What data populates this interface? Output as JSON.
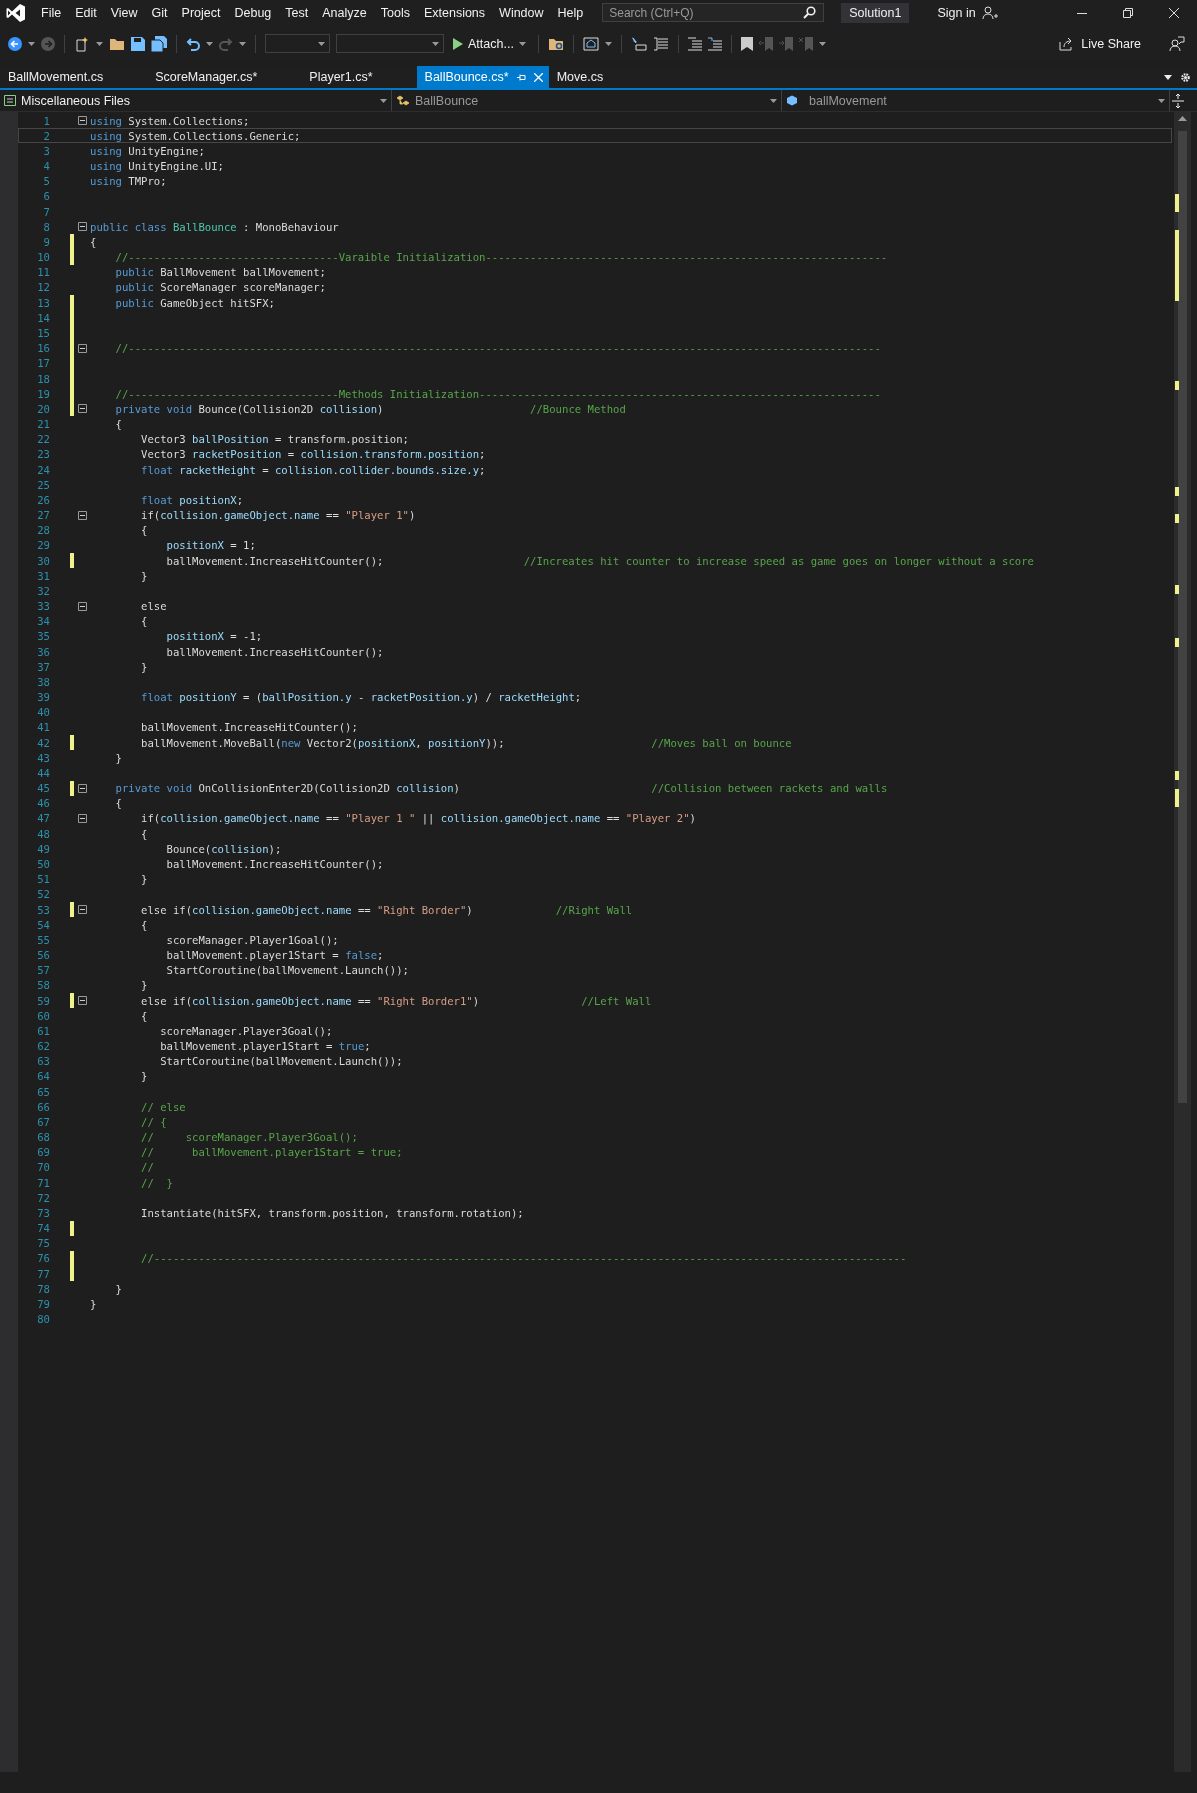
{
  "menu_bar": {
    "items": [
      "File",
      "Edit",
      "View",
      "Git",
      "Project",
      "Debug",
      "Test",
      "Analyze",
      "Tools",
      "Extensions",
      "Window",
      "Help"
    ],
    "search": {
      "placeholder": "Search (Ctrl+Q)"
    },
    "solution": "Solution1",
    "sign_in": "Sign in"
  },
  "toolbar": {
    "attach": "Attach...",
    "live_share": "Live Share"
  },
  "tabs": [
    {
      "label": "BallMovement.cs",
      "selected": false
    },
    {
      "label": "ScoreManager.cs*",
      "selected": false
    },
    {
      "label": "Player1.cs*",
      "selected": false
    },
    {
      "label": "BallBounce.cs*",
      "selected": true
    },
    {
      "label": "Move.cs",
      "selected": false
    }
  ],
  "nav_bar": {
    "project": "Miscellaneous Files",
    "type": "BallBounce",
    "member": "ballMovement"
  },
  "editor": {
    "lines": [
      {
        "number": "1",
        "current": false,
        "changed": false,
        "fold": true,
        "spans": [
          {
            "kind": "keyword",
            "text": "using"
          },
          {
            "kind": "plain",
            "text": " System.Collections;"
          }
        ]
      },
      {
        "number": "2",
        "current": true,
        "changed": false,
        "fold": false,
        "spans": [
          {
            "kind": "keyword",
            "text": "using"
          },
          {
            "kind": "plain",
            "text": " System.Collections.Generic;"
          }
        ]
      },
      {
        "number": "3",
        "current": false,
        "changed": false,
        "fold": false,
        "spans": [
          {
            "kind": "keyword",
            "text": "using"
          },
          {
            "kind": "plain",
            "text": " UnityEngine;"
          }
        ]
      },
      {
        "number": "4",
        "current": false,
        "changed": false,
        "fold": false,
        "spans": [
          {
            "kind": "keyword",
            "text": "using"
          },
          {
            "kind": "plain",
            "text": " UnityEngine.UI;"
          }
        ]
      },
      {
        "number": "5",
        "current": false,
        "changed": false,
        "fold": false,
        "spans": [
          {
            "kind": "keyword",
            "text": "using"
          },
          {
            "kind": "plain",
            "text": " TMPro;"
          }
        ]
      },
      {
        "number": "6",
        "current": false,
        "changed": false,
        "fold": false
      },
      {
        "number": "7",
        "current": false,
        "changed": false,
        "fold": false
      },
      {
        "number": "8",
        "current": false,
        "changed": false,
        "fold": true,
        "spans": [
          {
            "kind": "keyword",
            "text": "public class "
          },
          {
            "kind": "type",
            "text": "BallBounce"
          },
          {
            "kind": "plain",
            "text": " : MonoBehaviour"
          }
        ]
      },
      {
        "number": "9",
        "current": false,
        "changed": true,
        "fold": false,
        "spans": [
          {
            "kind": "plain",
            "text": "{"
          }
        ]
      },
      {
        "number": "10",
        "current": false,
        "changed": true,
        "fold": false,
        "spans": [
          {
            "kind": "comment",
            "text": "    //---------------------------------Varaible Initialization---------------------------------------------------------------"
          }
        ]
      },
      {
        "number": "11",
        "current": false,
        "changed": false,
        "fold": false,
        "spans": [
          {
            "kind": "keyword",
            "text": "    public"
          },
          {
            "kind": "plain",
            "text": " BallMovement ballMovement;"
          }
        ]
      },
      {
        "number": "12",
        "current": false,
        "changed": false,
        "fold": false,
        "spans": [
          {
            "kind": "keyword",
            "text": "    public"
          },
          {
            "kind": "plain",
            "text": " ScoreManager scoreManager;"
          }
        ]
      },
      {
        "number": "13",
        "current": false,
        "changed": true,
        "fold": false,
        "spans": [
          {
            "kind": "keyword",
            "text": "    public"
          },
          {
            "kind": "plain",
            "text": " GameObject hitSFX;"
          }
        ]
      },
      {
        "number": "14",
        "current": false,
        "changed": true,
        "fold": false
      },
      {
        "number": "15",
        "current": false,
        "changed": true,
        "fold": false
      },
      {
        "number": "16",
        "current": false,
        "changed": true,
        "fold": true,
        "spans": [
          {
            "kind": "comment",
            "text": "    //----------------------------------------------------------------------------------------------------------------------"
          }
        ]
      },
      {
        "number": "17",
        "current": false,
        "changed": true,
        "fold": false
      },
      {
        "number": "18",
        "current": false,
        "changed": true,
        "fold": false
      },
      {
        "number": "19",
        "current": false,
        "changed": true,
        "fold": false,
        "spans": [
          {
            "kind": "comment",
            "text": "    //---------------------------------Methods Initialization---------------------------------------------------------------"
          }
        ]
      },
      {
        "number": "20",
        "current": false,
        "changed": true,
        "fold": true,
        "spans": [
          {
            "kind": "keyword",
            "text": "    private void"
          },
          {
            "kind": "plain",
            "text": " Bounce(Collision2D "
          },
          {
            "kind": "variable",
            "text": "collision"
          },
          {
            "kind": "plain",
            "text": ")                       "
          },
          {
            "kind": "comment",
            "text": "//Bounce Method"
          }
        ]
      },
      {
        "number": "21",
        "current": false,
        "changed": false,
        "fold": false,
        "spans": [
          {
            "kind": "plain",
            "text": "    {"
          }
        ]
      },
      {
        "number": "22",
        "current": false,
        "changed": false,
        "fold": false,
        "spans": [
          {
            "kind": "plain",
            "text": "        Vector3 "
          },
          {
            "kind": "variable",
            "text": "ballPosition"
          },
          {
            "kind": "plain",
            "text": " = transform.position;"
          }
        ]
      },
      {
        "number": "23",
        "current": false,
        "changed": false,
        "fold": false,
        "spans": [
          {
            "kind": "plain",
            "text": "        Vector3 "
          },
          {
            "kind": "variable",
            "text": "racketPosition"
          },
          {
            "kind": "plain",
            "text": " = "
          },
          {
            "kind": "variable",
            "text": "collision.transform.position"
          },
          {
            "kind": "plain",
            "text": ";"
          }
        ]
      },
      {
        "number": "24",
        "current": false,
        "changed": false,
        "fold": false,
        "spans": [
          {
            "kind": "keyword",
            "text": "        float "
          },
          {
            "kind": "variable",
            "text": "racketHeight"
          },
          {
            "kind": "plain",
            "text": " = "
          },
          {
            "kind": "variable",
            "text": "collision.collider.bounds.size.y"
          },
          {
            "kind": "plain",
            "text": ";"
          }
        ]
      },
      {
        "number": "25",
        "current": false,
        "changed": false,
        "fold": false
      },
      {
        "number": "26",
        "current": false,
        "changed": false,
        "fold": false,
        "spans": [
          {
            "kind": "keyword",
            "text": "        float "
          },
          {
            "kind": "variable",
            "text": "positionX"
          },
          {
            "kind": "plain",
            "text": ";"
          }
        ]
      },
      {
        "number": "27",
        "current": false,
        "changed": false,
        "fold": true,
        "spans": [
          {
            "kind": "plain",
            "text": "        if("
          },
          {
            "kind": "variable",
            "text": "collision.gameObject.name"
          },
          {
            "kind": "plain",
            "text": " == "
          },
          {
            "kind": "string",
            "text": "\"Player 1\""
          },
          {
            "kind": "plain",
            "text": ")"
          }
        ]
      },
      {
        "number": "28",
        "current": false,
        "changed": false,
        "fold": false,
        "spans": [
          {
            "kind": "plain",
            "text": "        {"
          }
        ]
      },
      {
        "number": "29",
        "current": false,
        "changed": false,
        "fold": false,
        "spans": [
          {
            "kind": "variable",
            "text": "            positionX"
          },
          {
            "kind": "plain",
            "text": " = 1;"
          }
        ]
      },
      {
        "number": "30",
        "current": false,
        "changed": true,
        "fold": false,
        "spans": [
          {
            "kind": "plain",
            "text": "            ballMovement.IncreaseHitCounter();                      "
          },
          {
            "kind": "comment",
            "text": "//Increates hit counter to increase speed as game goes on longer without a score"
          }
        ]
      },
      {
        "number": "31",
        "current": false,
        "changed": false,
        "fold": false,
        "spans": [
          {
            "kind": "plain",
            "text": "        }"
          }
        ]
      },
      {
        "number": "32",
        "current": false,
        "changed": false,
        "fold": false
      },
      {
        "number": "33",
        "current": false,
        "changed": false,
        "fold": true,
        "spans": [
          {
            "kind": "plain",
            "text": "        else"
          }
        ]
      },
      {
        "number": "34",
        "current": false,
        "changed": false,
        "fold": false,
        "spans": [
          {
            "kind": "plain",
            "text": "        {"
          }
        ]
      },
      {
        "number": "35",
        "current": false,
        "changed": false,
        "fold": false,
        "spans": [
          {
            "kind": "variable",
            "text": "            positionX"
          },
          {
            "kind": "plain",
            "text": " = -1;"
          }
        ]
      },
      {
        "number": "36",
        "current": false,
        "changed": false,
        "fold": false,
        "spans": [
          {
            "kind": "plain",
            "text": "            ballMovement.IncreaseHitCounter();"
          }
        ]
      },
      {
        "number": "37",
        "current": false,
        "changed": false,
        "fold": false,
        "spans": [
          {
            "kind": "plain",
            "text": "        }"
          }
        ]
      },
      {
        "number": "38",
        "current": false,
        "changed": false,
        "fold": false
      },
      {
        "number": "39",
        "current": false,
        "changed": false,
        "fold": false,
        "spans": [
          {
            "kind": "keyword",
            "text": "        float "
          },
          {
            "kind": "variable",
            "text": "positionY"
          },
          {
            "kind": "plain",
            "text": " = ("
          },
          {
            "kind": "variable",
            "text": "ballPosition.y"
          },
          {
            "kind": "plain",
            "text": " - "
          },
          {
            "kind": "variable",
            "text": "racketPosition.y"
          },
          {
            "kind": "plain",
            "text": ") / "
          },
          {
            "kind": "variable",
            "text": "racketHeight"
          },
          {
            "kind": "plain",
            "text": ";"
          }
        ]
      },
      {
        "number": "40",
        "current": false,
        "changed": false,
        "fold": false
      },
      {
        "number": "41",
        "current": false,
        "changed": false,
        "fold": false,
        "spans": [
          {
            "kind": "plain",
            "text": "        ballMovement.IncreaseHitCounter();"
          }
        ]
      },
      {
        "number": "42",
        "current": false,
        "changed": true,
        "fold": false,
        "spans": [
          {
            "kind": "plain",
            "text": "        ballMovement.MoveBall("
          },
          {
            "kind": "keyword",
            "text": "new"
          },
          {
            "kind": "plain",
            "text": " Vector2("
          },
          {
            "kind": "variable",
            "text": "positionX"
          },
          {
            "kind": "plain",
            "text": ", "
          },
          {
            "kind": "variable",
            "text": "positionY"
          },
          {
            "kind": "plain",
            "text": "));                       "
          },
          {
            "kind": "comment",
            "text": "//Moves ball on bounce"
          }
        ]
      },
      {
        "number": "43",
        "current": false,
        "changed": false,
        "fold": false,
        "spans": [
          {
            "kind": "plain",
            "text": "    }"
          }
        ]
      },
      {
        "number": "44",
        "current": false,
        "changed": false,
        "fold": false
      },
      {
        "number": "45",
        "current": false,
        "changed": true,
        "fold": true,
        "spans": [
          {
            "kind": "keyword",
            "text": "    private void"
          },
          {
            "kind": "plain",
            "text": " OnCollisionEnter2D(Collision2D "
          },
          {
            "kind": "variable",
            "text": "collision"
          },
          {
            "kind": "plain",
            "text": ")                              "
          },
          {
            "kind": "comment",
            "text": "//Collision between rackets and walls"
          }
        ]
      },
      {
        "number": "46",
        "current": false,
        "changed": false,
        "fold": false,
        "spans": [
          {
            "kind": "plain",
            "text": "    {"
          }
        ]
      },
      {
        "number": "47",
        "current": false,
        "changed": false,
        "fold": true,
        "spans": [
          {
            "kind": "plain",
            "text": "        if("
          },
          {
            "kind": "variable",
            "text": "collision.gameObject.name"
          },
          {
            "kind": "plain",
            "text": " == "
          },
          {
            "kind": "string",
            "text": "\"Player 1 \""
          },
          {
            "kind": "plain",
            "text": " || "
          },
          {
            "kind": "variable",
            "text": "collision.gameObject.name"
          },
          {
            "kind": "plain",
            "text": " == "
          },
          {
            "kind": "string",
            "text": "\"Player 2\""
          },
          {
            "kind": "plain",
            "text": ")"
          }
        ]
      },
      {
        "number": "48",
        "current": false,
        "changed": false,
        "fold": false,
        "spans": [
          {
            "kind": "plain",
            "text": "        {"
          }
        ]
      },
      {
        "number": "49",
        "current": false,
        "changed": false,
        "fold": false,
        "spans": [
          {
            "kind": "plain",
            "text": "            Bounce("
          },
          {
            "kind": "variable",
            "text": "collision"
          },
          {
            "kind": "plain",
            "text": ");"
          }
        ]
      },
      {
        "number": "50",
        "current": false,
        "changed": false,
        "fold": false,
        "spans": [
          {
            "kind": "plain",
            "text": "            ballMovement.IncreaseHitCounter();"
          }
        ]
      },
      {
        "number": "51",
        "current": false,
        "changed": false,
        "fold": false,
        "spans": [
          {
            "kind": "plain",
            "text": "        }"
          }
        ]
      },
      {
        "number": "52",
        "current": false,
        "changed": false,
        "fold": false
      },
      {
        "number": "53",
        "current": false,
        "changed": true,
        "fold": true,
        "spans": [
          {
            "kind": "plain",
            "text": "        else if("
          },
          {
            "kind": "variable",
            "text": "collision.gameObject.name"
          },
          {
            "kind": "plain",
            "text": " == "
          },
          {
            "kind": "string",
            "text": "\"Right Border\""
          },
          {
            "kind": "plain",
            "text": ")             "
          },
          {
            "kind": "comment",
            "text": "//Right Wall"
          }
        ]
      },
      {
        "number": "54",
        "current": false,
        "changed": false,
        "fold": false,
        "spans": [
          {
            "kind": "plain",
            "text": "        {"
          }
        ]
      },
      {
        "number": "55",
        "current": false,
        "changed": false,
        "fold": false,
        "spans": [
          {
            "kind": "plain",
            "text": "            scoreManager.Player1Goal();"
          }
        ]
      },
      {
        "number": "56",
        "current": false,
        "changed": false,
        "fold": false,
        "spans": [
          {
            "kind": "plain",
            "text": "            ballMovement.player1Start = "
          },
          {
            "kind": "keyword",
            "text": "false"
          },
          {
            "kind": "plain",
            "text": ";"
          }
        ]
      },
      {
        "number": "57",
        "current": false,
        "changed": false,
        "fold": false,
        "spans": [
          {
            "kind": "plain",
            "text": "            StartCoroutine(ballMovement.Launch());"
          }
        ]
      },
      {
        "number": "58",
        "current": false,
        "changed": false,
        "fold": false,
        "spans": [
          {
            "kind": "plain",
            "text": "        }"
          }
        ]
      },
      {
        "number": "59",
        "current": false,
        "changed": true,
        "fold": true,
        "spans": [
          {
            "kind": "plain",
            "text": "        else if("
          },
          {
            "kind": "variable",
            "text": "collision.gameObject.name"
          },
          {
            "kind": "plain",
            "text": " == "
          },
          {
            "kind": "string",
            "text": "\"Right Border1\""
          },
          {
            "kind": "plain",
            "text": ")                "
          },
          {
            "kind": "comment",
            "text": "//Left Wall"
          }
        ]
      },
      {
        "number": "60",
        "current": false,
        "changed": false,
        "fold": false,
        "spans": [
          {
            "kind": "plain",
            "text": "        {"
          }
        ]
      },
      {
        "number": "61",
        "current": false,
        "changed": false,
        "fold": false,
        "spans": [
          {
            "kind": "plain",
            "text": "           scoreManager.Player3Goal();"
          }
        ]
      },
      {
        "number": "62",
        "current": false,
        "changed": false,
        "fold": false,
        "spans": [
          {
            "kind": "plain",
            "text": "           ballMovement.player1Start = "
          },
          {
            "kind": "keyword",
            "text": "true"
          },
          {
            "kind": "plain",
            "text": ";"
          }
        ]
      },
      {
        "number": "63",
        "current": false,
        "changed": false,
        "fold": false,
        "spans": [
          {
            "kind": "plain",
            "text": "           StartCoroutine(ballMovement.Launch());"
          }
        ]
      },
      {
        "number": "64",
        "current": false,
        "changed": false,
        "fold": false,
        "spans": [
          {
            "kind": "plain",
            "text": "        }"
          }
        ]
      },
      {
        "number": "65",
        "current": false,
        "changed": false,
        "fold": false
      },
      {
        "number": "66",
        "current": false,
        "changed": false,
        "fold": false,
        "spans": [
          {
            "kind": "comment",
            "text": "        // else"
          }
        ]
      },
      {
        "number": "67",
        "current": false,
        "changed": false,
        "fold": false,
        "spans": [
          {
            "kind": "comment",
            "text": "        // {"
          }
        ]
      },
      {
        "number": "68",
        "current": false,
        "changed": false,
        "fold": false,
        "spans": [
          {
            "kind": "comment",
            "text": "        //     scoreManager.Player3Goal();"
          }
        ]
      },
      {
        "number": "69",
        "current": false,
        "changed": false,
        "fold": false,
        "spans": [
          {
            "kind": "comment",
            "text": "        //      ballMovement.player1Start = true;"
          }
        ]
      },
      {
        "number": "70",
        "current": false,
        "changed": false,
        "fold": false,
        "spans": [
          {
            "kind": "comment",
            "text": "        //"
          }
        ]
      },
      {
        "number": "71",
        "current": false,
        "changed": false,
        "fold": false,
        "spans": [
          {
            "kind": "comment",
            "text": "        //  }"
          }
        ]
      },
      {
        "number": "72",
        "current": false,
        "changed": false,
        "fold": false
      },
      {
        "number": "73",
        "current": false,
        "changed": false,
        "fold": false,
        "spans": [
          {
            "kind": "plain",
            "text": "        Instantiate(hitSFX, transform.position, transform.rotation);"
          }
        ]
      },
      {
        "number": "74",
        "current": false,
        "changed": true,
        "fold": false
      },
      {
        "number": "75",
        "current": false,
        "changed": false,
        "fold": false
      },
      {
        "number": "76",
        "current": false,
        "changed": true,
        "fold": false,
        "spans": [
          {
            "kind": "comment",
            "text": "        //----------------------------------------------------------------------------------------------------------------------"
          }
        ]
      },
      {
        "number": "77",
        "current": false,
        "changed": true,
        "fold": false
      },
      {
        "number": "78",
        "current": false,
        "changed": false,
        "fold": false,
        "spans": [
          {
            "kind": "plain",
            "text": "    }"
          }
        ]
      },
      {
        "number": "79",
        "current": false,
        "changed": false,
        "fold": false,
        "spans": [
          {
            "kind": "plain",
            "text": "}"
          }
        ]
      },
      {
        "number": "80",
        "current": false,
        "changed": false,
        "fold": false
      }
    ]
  }
}
